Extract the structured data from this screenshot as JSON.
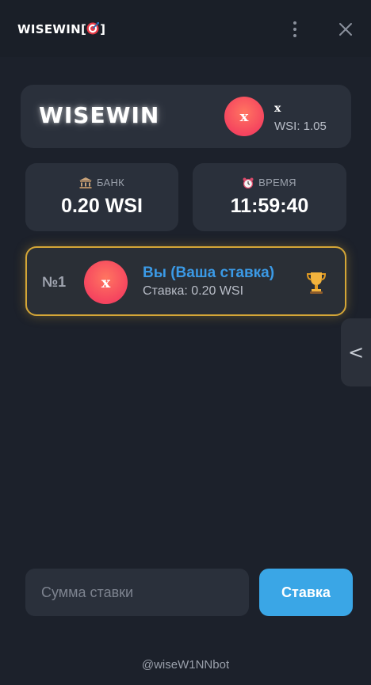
{
  "titlebar": {
    "title": "WISEWIN[",
    "title_icon": "dart-target-icon",
    "title_suffix": "]",
    "menu_icon": "kebab-menu-icon",
    "close_icon": "close-icon"
  },
  "profile": {
    "brand": "WISEWIN",
    "avatar_letter": "x",
    "name": "x",
    "balance": "WSI: 1.05"
  },
  "stats": {
    "bank": {
      "icon": "bank-icon",
      "label": "БАНК",
      "value": "0.20 WSI"
    },
    "time": {
      "icon": "alarm-clock-icon",
      "label": "ВРЕМЯ",
      "value": "11:59:40"
    }
  },
  "bets": [
    {
      "rank": "№1",
      "avatar_letter": "x",
      "name": "Вы (Ваша ставка)",
      "amount": "Ставка: 0.20 WSI",
      "icon": "trophy-icon"
    }
  ],
  "side_tab": {
    "label": "<",
    "icon": "chevron-left-icon"
  },
  "bet_form": {
    "placeholder": "Сумма ставки",
    "value": "",
    "button_label": "Ставка"
  },
  "footer": {
    "link": "@wiseW1NNbot"
  },
  "colors": {
    "background": "#1c212b",
    "card": "#2a303b",
    "accent_blue": "#3aa6e6",
    "gold_border": "#d4a637",
    "avatar": "#f5445f"
  }
}
